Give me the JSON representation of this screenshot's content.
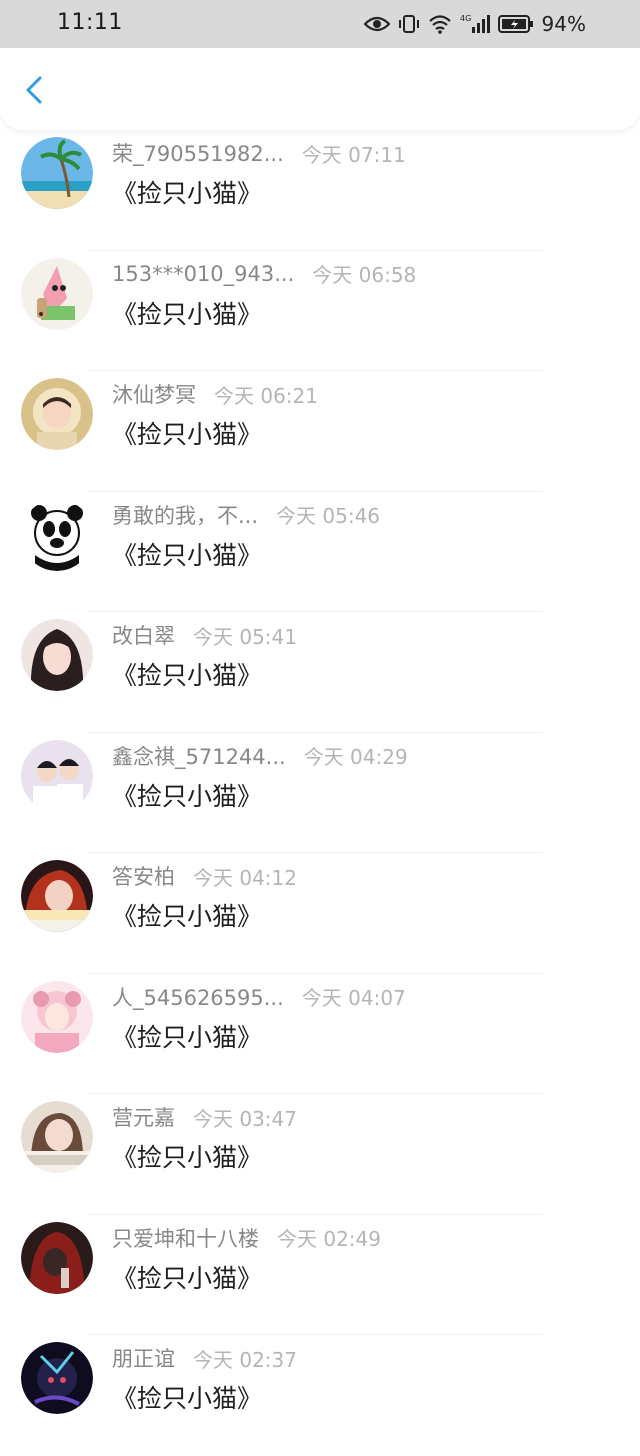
{
  "status_bar": {
    "time": "11:11",
    "battery": "94%"
  },
  "header": {
    "back_icon": "chevron-left-icon",
    "accent": "#2f9be8"
  },
  "items": [
    {
      "name": "荣_790551982...",
      "time": "今天 07:11",
      "message": "《捡只小猫》"
    },
    {
      "name": "153***010_943...",
      "time": "今天 06:58",
      "message": "《捡只小猫》"
    },
    {
      "name": "沐仙梦冥",
      "time": "今天 06:21",
      "message": "《捡只小猫》"
    },
    {
      "name": "勇敢的我，不...",
      "time": "今天 05:46",
      "message": "《捡只小猫》"
    },
    {
      "name": "改白翠",
      "time": "今天 05:41",
      "message": "《捡只小猫》"
    },
    {
      "name": "鑫念祺_571244...",
      "time": "今天 04:29",
      "message": "《捡只小猫》"
    },
    {
      "name": "答安柏",
      "time": "今天 04:12",
      "message": "《捡只小猫》"
    },
    {
      "name": "人_545626595...",
      "time": "今天 04:07",
      "message": "《捡只小猫》"
    },
    {
      "name": "营元嘉",
      "time": "今天 03:47",
      "message": "《捡只小猫》"
    },
    {
      "name": "只爱坤和十八楼",
      "time": "今天 02:49",
      "message": "《捡只小猫》"
    },
    {
      "name": "朋正谊",
      "time": "今天 02:37",
      "message": "《捡只小猫》"
    }
  ]
}
